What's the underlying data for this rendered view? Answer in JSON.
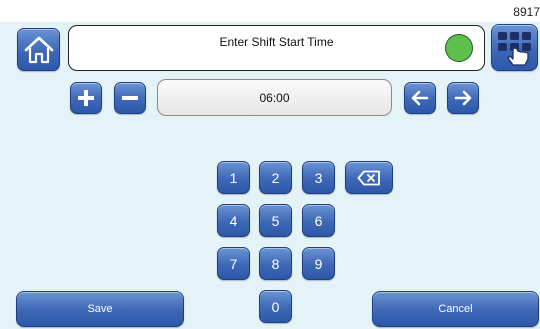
{
  "header": {
    "device_id": "8917",
    "title": "Enter Shift Start Time",
    "status_color": "#5ec04a",
    "home_icon": "home-icon",
    "menu_icon": "keypad-hand-icon"
  },
  "entry": {
    "value": "06:00",
    "increment_icon": "plus-icon",
    "decrement_icon": "minus-icon",
    "prev_icon": "arrow-left-icon",
    "next_icon": "arrow-right-icon"
  },
  "keypad": {
    "keys": [
      "1",
      "2",
      "3",
      "4",
      "5",
      "6",
      "7",
      "8",
      "9",
      "0"
    ],
    "backspace_icon": "backspace-icon"
  },
  "footer": {
    "save_label": "Save",
    "cancel_label": "Cancel"
  },
  "colors": {
    "accent": "#3e67b6",
    "background": "#e4f3f8"
  }
}
